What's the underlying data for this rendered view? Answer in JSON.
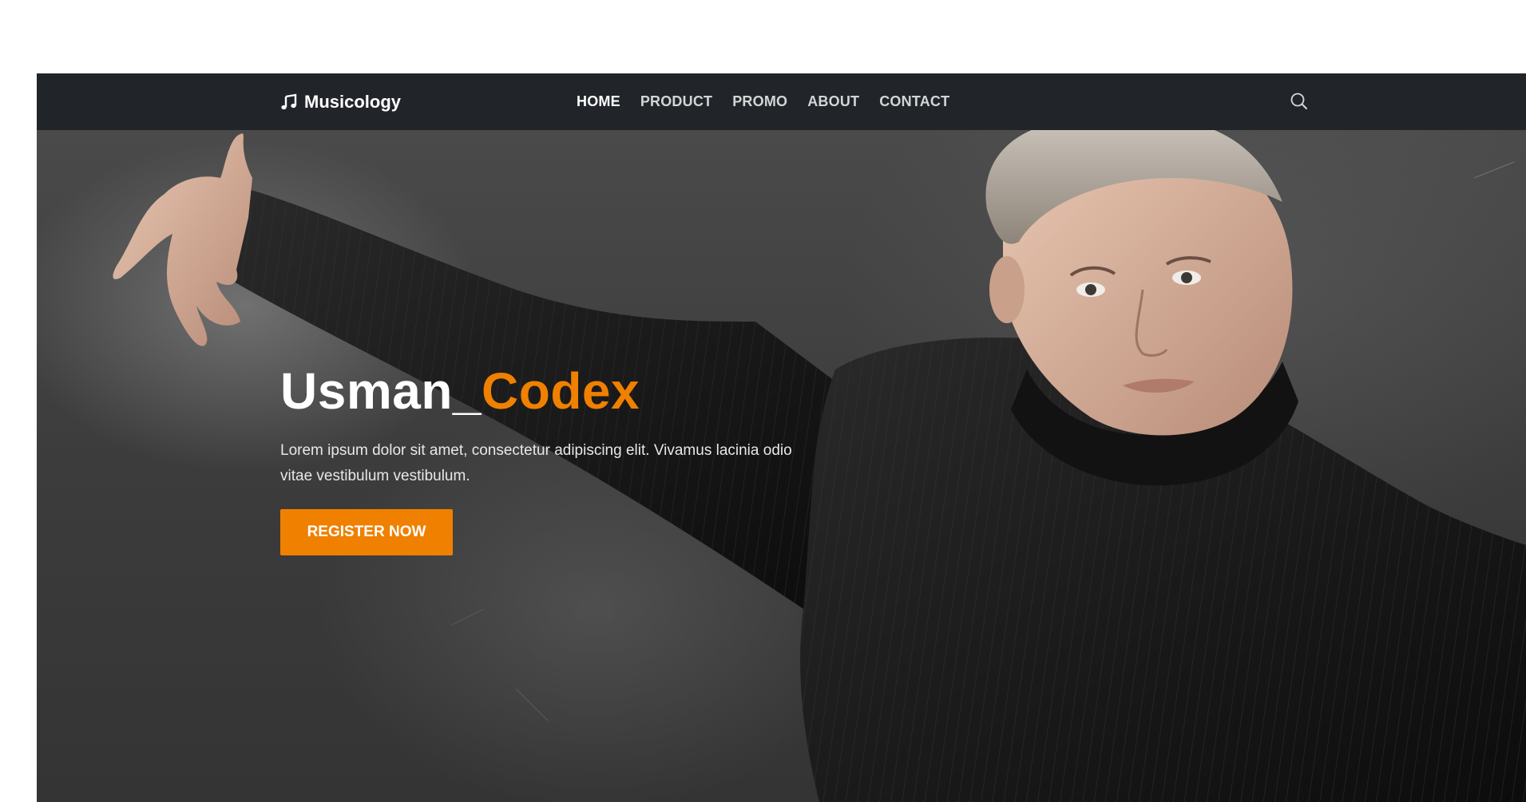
{
  "navbar": {
    "brand": "Musicology",
    "brand_icon": "music-note-icon",
    "items": [
      {
        "label": "HOME",
        "active": true
      },
      {
        "label": "PRODUCT",
        "active": false
      },
      {
        "label": "PROMO",
        "active": false
      },
      {
        "label": "ABOUT",
        "active": false
      },
      {
        "label": "CONTACT",
        "active": false
      }
    ],
    "search_icon": "search-icon"
  },
  "hero": {
    "title_main": "Usman_",
    "title_accent": "Codex",
    "text": "Lorem ipsum dolor sit amet, consectetur adipiscing elit. Vivamus lacinia odio vitae vestibulum vestibulum.",
    "button_label": "REGISTER NOW"
  },
  "colors": {
    "navbar_bg": "#212529",
    "accent": "#f08000",
    "text_light": "#ffffff"
  }
}
